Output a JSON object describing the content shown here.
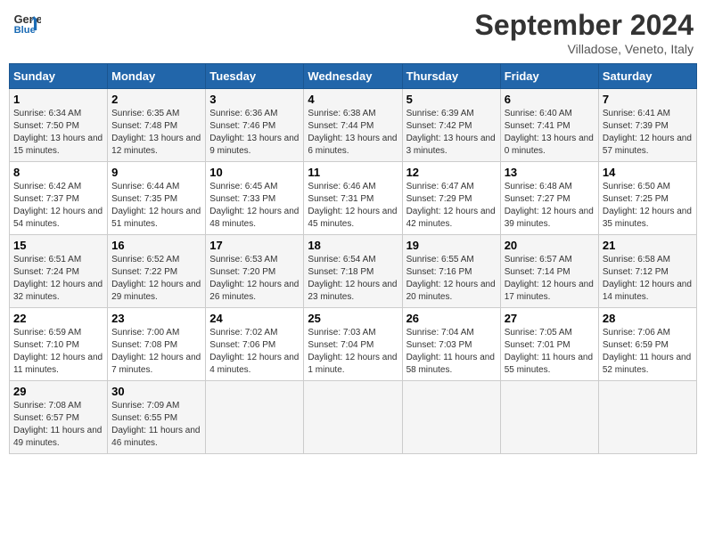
{
  "header": {
    "logo_line1": "General",
    "logo_line2": "Blue",
    "month": "September 2024",
    "location": "Villadose, Veneto, Italy"
  },
  "days_of_week": [
    "Sunday",
    "Monday",
    "Tuesday",
    "Wednesday",
    "Thursday",
    "Friday",
    "Saturday"
  ],
  "weeks": [
    [
      {
        "day": "1",
        "sunrise": "6:34 AM",
        "sunset": "7:50 PM",
        "daylight": "13 hours and 15 minutes."
      },
      {
        "day": "2",
        "sunrise": "6:35 AM",
        "sunset": "7:48 PM",
        "daylight": "13 hours and 12 minutes."
      },
      {
        "day": "3",
        "sunrise": "6:36 AM",
        "sunset": "7:46 PM",
        "daylight": "13 hours and 9 minutes."
      },
      {
        "day": "4",
        "sunrise": "6:38 AM",
        "sunset": "7:44 PM",
        "daylight": "13 hours and 6 minutes."
      },
      {
        "day": "5",
        "sunrise": "6:39 AM",
        "sunset": "7:42 PM",
        "daylight": "13 hours and 3 minutes."
      },
      {
        "day": "6",
        "sunrise": "6:40 AM",
        "sunset": "7:41 PM",
        "daylight": "13 hours and 0 minutes."
      },
      {
        "day": "7",
        "sunrise": "6:41 AM",
        "sunset": "7:39 PM",
        "daylight": "12 hours and 57 minutes."
      }
    ],
    [
      {
        "day": "8",
        "sunrise": "6:42 AM",
        "sunset": "7:37 PM",
        "daylight": "12 hours and 54 minutes."
      },
      {
        "day": "9",
        "sunrise": "6:44 AM",
        "sunset": "7:35 PM",
        "daylight": "12 hours and 51 minutes."
      },
      {
        "day": "10",
        "sunrise": "6:45 AM",
        "sunset": "7:33 PM",
        "daylight": "12 hours and 48 minutes."
      },
      {
        "day": "11",
        "sunrise": "6:46 AM",
        "sunset": "7:31 PM",
        "daylight": "12 hours and 45 minutes."
      },
      {
        "day": "12",
        "sunrise": "6:47 AM",
        "sunset": "7:29 PM",
        "daylight": "12 hours and 42 minutes."
      },
      {
        "day": "13",
        "sunrise": "6:48 AM",
        "sunset": "7:27 PM",
        "daylight": "12 hours and 39 minutes."
      },
      {
        "day": "14",
        "sunrise": "6:50 AM",
        "sunset": "7:25 PM",
        "daylight": "12 hours and 35 minutes."
      }
    ],
    [
      {
        "day": "15",
        "sunrise": "6:51 AM",
        "sunset": "7:24 PM",
        "daylight": "12 hours and 32 minutes."
      },
      {
        "day": "16",
        "sunrise": "6:52 AM",
        "sunset": "7:22 PM",
        "daylight": "12 hours and 29 minutes."
      },
      {
        "day": "17",
        "sunrise": "6:53 AM",
        "sunset": "7:20 PM",
        "daylight": "12 hours and 26 minutes."
      },
      {
        "day": "18",
        "sunrise": "6:54 AM",
        "sunset": "7:18 PM",
        "daylight": "12 hours and 23 minutes."
      },
      {
        "day": "19",
        "sunrise": "6:55 AM",
        "sunset": "7:16 PM",
        "daylight": "12 hours and 20 minutes."
      },
      {
        "day": "20",
        "sunrise": "6:57 AM",
        "sunset": "7:14 PM",
        "daylight": "12 hours and 17 minutes."
      },
      {
        "day": "21",
        "sunrise": "6:58 AM",
        "sunset": "7:12 PM",
        "daylight": "12 hours and 14 minutes."
      }
    ],
    [
      {
        "day": "22",
        "sunrise": "6:59 AM",
        "sunset": "7:10 PM",
        "daylight": "12 hours and 11 minutes."
      },
      {
        "day": "23",
        "sunrise": "7:00 AM",
        "sunset": "7:08 PM",
        "daylight": "12 hours and 7 minutes."
      },
      {
        "day": "24",
        "sunrise": "7:02 AM",
        "sunset": "7:06 PM",
        "daylight": "12 hours and 4 minutes."
      },
      {
        "day": "25",
        "sunrise": "7:03 AM",
        "sunset": "7:04 PM",
        "daylight": "12 hours and 1 minute."
      },
      {
        "day": "26",
        "sunrise": "7:04 AM",
        "sunset": "7:03 PM",
        "daylight": "11 hours and 58 minutes."
      },
      {
        "day": "27",
        "sunrise": "7:05 AM",
        "sunset": "7:01 PM",
        "daylight": "11 hours and 55 minutes."
      },
      {
        "day": "28",
        "sunrise": "7:06 AM",
        "sunset": "6:59 PM",
        "daylight": "11 hours and 52 minutes."
      }
    ],
    [
      {
        "day": "29",
        "sunrise": "7:08 AM",
        "sunset": "6:57 PM",
        "daylight": "11 hours and 49 minutes."
      },
      {
        "day": "30",
        "sunrise": "7:09 AM",
        "sunset": "6:55 PM",
        "daylight": "11 hours and 46 minutes."
      },
      null,
      null,
      null,
      null,
      null
    ]
  ]
}
